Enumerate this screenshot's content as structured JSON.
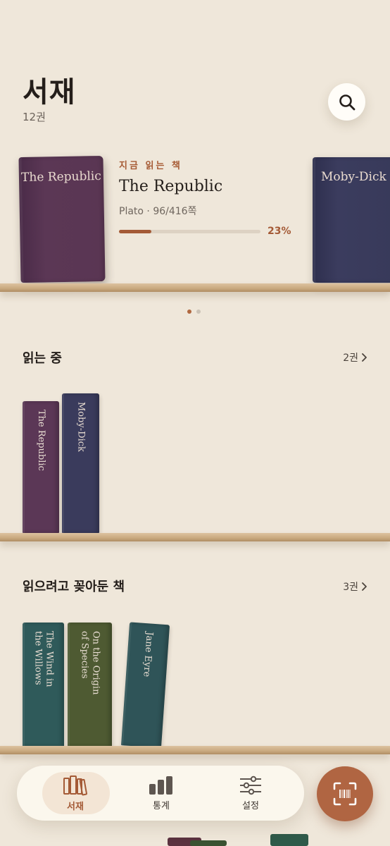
{
  "header": {
    "title": "서재",
    "count": "12권"
  },
  "featured": {
    "now_label": "지금 읽는 책",
    "book_title": "The Republic",
    "meta": "Plato · 96/416쪽",
    "progress": 0.23,
    "progress_label": "23%",
    "cover_title_left": "The Republic",
    "cover_title_right": "Moby-Dick",
    "page_index": 0,
    "page_count": 2
  },
  "sections": {
    "reading": {
      "title": "읽는 중",
      "count": "2권",
      "books": [
        {
          "title": "The Republic",
          "color": "#5b3756"
        },
        {
          "title": "Moby-Dick",
          "color": "#3a3b5c"
        }
      ]
    },
    "want": {
      "title": "읽으려고 꽂아둔 책",
      "count": "3권",
      "books": [
        {
          "title": "The Wind in\nthe Willows",
          "color": "#2f5a5a"
        },
        {
          "title": "On the Origin\nof Species",
          "color": "#4e5a32"
        },
        {
          "title": "Jane Eyre",
          "color": "#2f5458"
        }
      ]
    }
  },
  "tabbar": {
    "tabs": [
      {
        "label": "서재",
        "icon": "bookshelf-icon"
      },
      {
        "label": "통계",
        "icon": "bar-chart-icon"
      },
      {
        "label": "설정",
        "icon": "sliders-icon"
      }
    ],
    "active": 0,
    "scan_icon": "barcode-scan-icon"
  },
  "colors": {
    "accent": "#a45a36",
    "background": "#efe7da"
  }
}
